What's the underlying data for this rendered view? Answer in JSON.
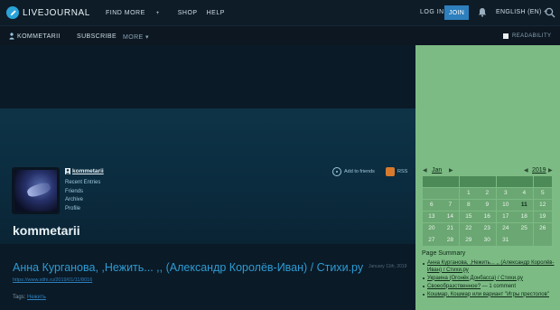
{
  "topbar": {
    "logo_text": "LIVEJOURNAL",
    "nav": [
      "FIND MORE",
      "SHOP",
      "HELP"
    ],
    "login": "LOG IN",
    "join": "JOIN",
    "language": "ENGLISH (EN)"
  },
  "journal_bar": {
    "username": "KOMMETARII",
    "subscribe": "SUBSCRIBE",
    "more": "MORE",
    "readability": "READABILITY"
  },
  "profile": {
    "username": "kommetarii",
    "links": [
      "Recent Entries",
      "Friends",
      "Archive",
      "Profile"
    ],
    "add_to_friends": "Add to friends",
    "rss": "RSS",
    "journal_title": "kommetarii"
  },
  "post": {
    "title": "Анна Курганова, ,Нежить... ,, (Александр Королёв-Иван) / Стихи.ру",
    "date": "January 11th, 2019",
    "url": "https://www.stihi.ru/2019/01/11/8016",
    "tags_label": "Tags:",
    "tag": "Нежить"
  },
  "calendar": {
    "month": "Jan",
    "year": "2019",
    "weeks": [
      [
        "",
        "",
        "1",
        "2",
        "3",
        "4",
        "5"
      ],
      [
        "6",
        "7",
        "8",
        "9",
        "10",
        "11",
        "12"
      ],
      [
        "13",
        "14",
        "15",
        "16",
        "17",
        "18",
        "19"
      ],
      [
        "20",
        "21",
        "22",
        "23",
        "24",
        "25",
        "26"
      ],
      [
        "27",
        "28",
        "29",
        "30",
        "31",
        "",
        ""
      ]
    ],
    "today": "11"
  },
  "page_summary": {
    "title": "Page Summary",
    "items": [
      {
        "link": "Анна Курганова, ,Нежить... ,, (Александр Королёв-Иван) / Стихи.ру",
        "extra": ""
      },
      {
        "link": "Украина (Огонёк Донбасса) / Стихи.ру",
        "extra": ""
      },
      {
        "link": "Своеобразственное?",
        "extra": " — 1 comment"
      },
      {
        "link": "Кошмар, Кошмар или вариант \"Игры престолов\"",
        "extra": ""
      }
    ]
  },
  "colors": {
    "accent_blue": "#2e7fbd",
    "sidebar_green": "#7dbb84",
    "link_blue": "#2e9bd3"
  }
}
